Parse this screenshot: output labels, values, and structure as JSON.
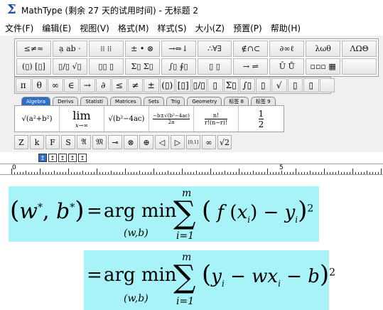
{
  "window": {
    "title": "MathType (剩余 27 天的试用时间) - 无标题 2"
  },
  "menu": [
    "文件(F)",
    "编辑(E)",
    "视图(V)",
    "格式(M)",
    "样式(S)",
    "大小(Z)",
    "预置(P)",
    "帮助(H)"
  ],
  "symbol_palettes": [
    "≤≠≈",
    "ạ ab ·",
    "⁞⁞ ⁞⁞",
    "± • ⊗",
    "→⇔↓",
    "∴∀∃",
    "∉∩⊂",
    "∂∞ℓ",
    "λωθ",
    "ΛΩΘ",
    "(▯) [▯]",
    "▯/▯ √▯",
    "▯▯ ▯",
    "Σ▯ Σ▯",
    "∫▯ ∮▯",
    "▯ ▯",
    "→ ⇌",
    "Ū Ů",
    "▫▫▫ ▦",
    ""
  ],
  "small_bar": [
    "π",
    "θ",
    "∞",
    "∈",
    "→",
    "∂",
    "≤",
    "≠",
    "±",
    "(▯)",
    "[▯]",
    "▯/▯",
    "▯",
    "Σ▯",
    "∫▯",
    "▯",
    "√",
    "▯",
    "▯",
    ""
  ],
  "tabs": [
    "Algebra",
    "Derivs",
    "Statisti",
    "Matrices",
    "Sets",
    "Trig",
    "Geometry",
    "标签 8",
    "标签 9"
  ],
  "active_tab": "Algebra",
  "templates": [
    {
      "name": "sqrt-a2-b2",
      "text": "√(a²+b²)"
    },
    {
      "name": "limit",
      "top": "lim",
      "bottom": "x→∞"
    },
    {
      "name": "sqrt-b2-4ac",
      "text": "√(b²−4ac)"
    },
    {
      "name": "quadratic",
      "num": "−b±√(b²−4ac)",
      "den": "2a"
    },
    {
      "name": "combination",
      "num": "n!",
      "den": "r!(n−r)!"
    },
    {
      "name": "one-half",
      "num": "1",
      "den": "2"
    }
  ],
  "icon_bar": [
    "Z",
    "k",
    "F",
    "S",
    "𝔄",
    "𝔐",
    "⊸",
    "⊗",
    "⊕",
    "◁",
    "▷",
    "[0,1]",
    "∞",
    "√2"
  ],
  "ruler": {
    "start": "0",
    "mark": "5"
  },
  "equation": {
    "line1_lhs": "(w*, b*)",
    "eq_sign": "=",
    "argmin": "arg min",
    "argmin_sub": "(w,b)",
    "sum_top": "m",
    "sum_bot": "i=1",
    "line1_body": "( f (xi) − yi )",
    "line1_exp": "2",
    "line2_body": "( yi − wxi − b )",
    "line2_exp": "2"
  },
  "highlight_color": "#a8f3f8",
  "accent_color": "#2f6fc9"
}
